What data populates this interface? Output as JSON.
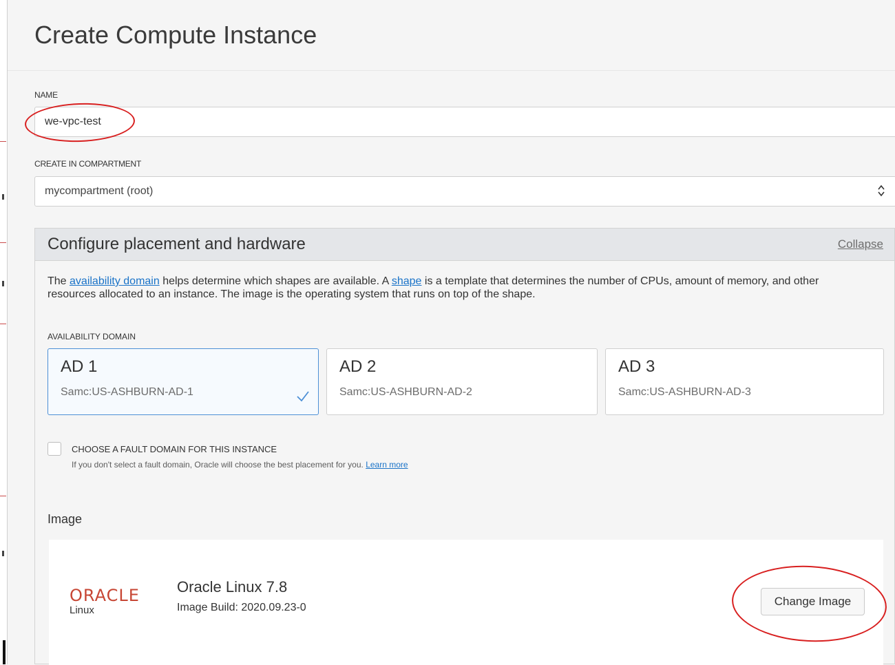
{
  "page": {
    "title": "Create Compute Instance"
  },
  "name_field": {
    "label": "NAME",
    "value": "we-vpc-test"
  },
  "compartment_field": {
    "label": "CREATE IN COMPARTMENT",
    "value": "mycompartment (root)"
  },
  "placement_panel": {
    "title": "Configure placement and hardware",
    "collapse_label": "Collapse",
    "description": {
      "part1": "The ",
      "link1": "availability domain",
      "part2": " helps determine which shapes are available. A ",
      "link2": "shape",
      "part3": " is a template that determines the number of CPUs, amount of memory, and other resources allocated to an instance. The image is the operating system that runs on top of the shape."
    },
    "availability_domain": {
      "label": "AVAILABILITY DOMAIN",
      "options": [
        {
          "name": "AD 1",
          "id": "Samc:US-ASHBURN-AD-1",
          "selected": true
        },
        {
          "name": "AD 2",
          "id": "Samc:US-ASHBURN-AD-2",
          "selected": false
        },
        {
          "name": "AD 3",
          "id": "Samc:US-ASHBURN-AD-3",
          "selected": false
        }
      ]
    },
    "fault_domain": {
      "label": "CHOOSE A FAULT DOMAIN FOR THIS INSTANCE",
      "help": "If you don't select a fault domain, Oracle will choose the best placement for you.",
      "learn_more": "Learn more",
      "checked": false
    },
    "image": {
      "heading": "Image",
      "logo_word": "ORACLE",
      "logo_sub": "Linux",
      "name": "Oracle Linux 7.8",
      "build": "Image Build: 2020.09.23-0",
      "change_button": "Change Image"
    }
  },
  "colors": {
    "accent_link": "#1a73c8",
    "selected_border": "#4c8fd6",
    "oracle_red": "#c74634",
    "annotation_red": "#d81f1f"
  }
}
